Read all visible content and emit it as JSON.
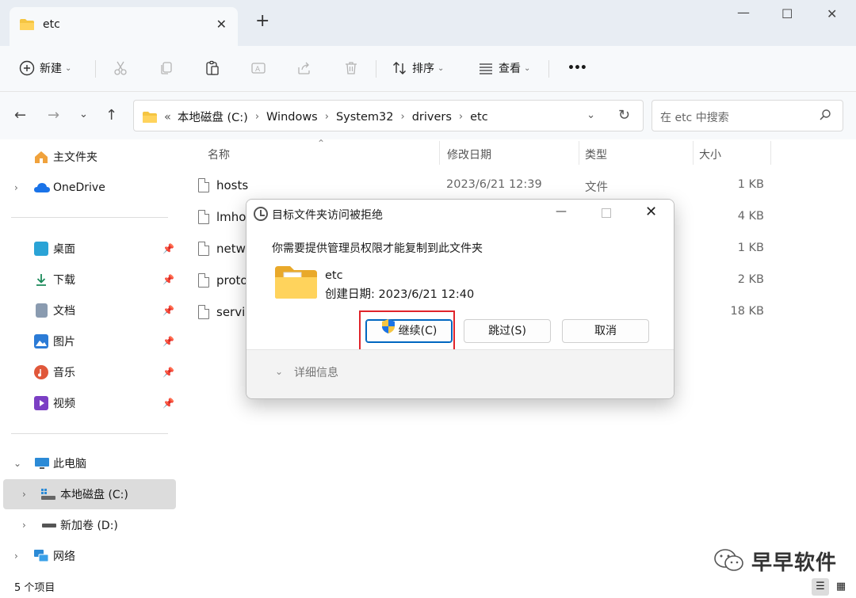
{
  "tab": {
    "title": "etc"
  },
  "toolbar": {
    "new_label": "新建",
    "sort_label": "排序",
    "view_label": "查看",
    "more_label": "•••"
  },
  "address": {
    "prefix": "«",
    "crumbs": [
      "本地磁盘 (C:)",
      "Windows",
      "System32",
      "drivers",
      "etc"
    ]
  },
  "search": {
    "placeholder": "在 etc 中搜索"
  },
  "sidebar": {
    "home": "主文件夹",
    "onedrive": "OneDrive",
    "pinned": [
      {
        "label": "桌面",
        "icon": "desktop-icon"
      },
      {
        "label": "下载",
        "icon": "download-icon"
      },
      {
        "label": "文档",
        "icon": "document-icon"
      },
      {
        "label": "图片",
        "icon": "picture-icon"
      },
      {
        "label": "音乐",
        "icon": "music-icon"
      },
      {
        "label": "视频",
        "icon": "video-icon"
      }
    ],
    "thispc": "此电脑",
    "drive_c": "本地磁盘 (C:)",
    "drive_d": "新加卷 (D:)",
    "network": "网络"
  },
  "columns": {
    "name": "名称",
    "modified": "修改日期",
    "type": "类型",
    "size": "大小"
  },
  "files": [
    {
      "name": "hosts",
      "modified": "2023/6/21 12:39",
      "type": "文件",
      "size": "1 KB"
    },
    {
      "name": "lmho",
      "modified": "",
      "type": "",
      "size": "4 KB"
    },
    {
      "name": "netw",
      "modified": "",
      "type": "",
      "size": "1 KB"
    },
    {
      "name": "proto",
      "modified": "",
      "type": "",
      "size": "2 KB"
    },
    {
      "name": "servi",
      "modified": "",
      "type": "",
      "size": "18 KB"
    }
  ],
  "status": {
    "count": "5 个项目"
  },
  "dialog": {
    "title": "目标文件夹访问被拒绝",
    "message": "你需要提供管理员权限才能复制到此文件夹",
    "folder_name": "etc",
    "created": "创建日期: 2023/6/21 12:40",
    "continue_label": "继续(C)",
    "skip_label": "跳过(S)",
    "cancel_label": "取消",
    "details_label": "详细信息"
  },
  "watermark": {
    "text": "早早软件"
  },
  "colors": {
    "accent": "#0067c0",
    "highlight_box": "#e0242b",
    "folder": "#f5c542"
  }
}
